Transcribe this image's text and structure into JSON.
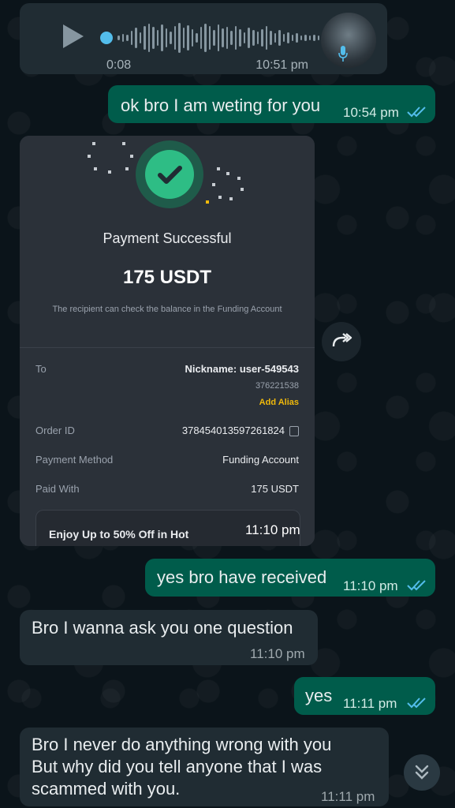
{
  "voice_message": {
    "duration": "0:08",
    "time": "10:51 pm",
    "play_icon": "play-icon",
    "mic_icon": "mic-icon",
    "accent": "#53bdeb"
  },
  "messages": [
    {
      "text": "ok bro I am weting for you",
      "time": "10:54 pm",
      "status": "read"
    },
    {
      "text": "yes bro have received",
      "time": "11:10 pm",
      "status": "read"
    },
    {
      "text": "Bro I wanna ask you one question",
      "time": "11:10 pm"
    },
    {
      "text": "yes",
      "time": "11:11 pm",
      "status": "read"
    },
    {
      "lines": [
        "Bro I never do anything wrong with you",
        "But why did you tell anyone that I was",
        "scammed with you."
      ],
      "time": "11:11 pm"
    }
  ],
  "payment_image": {
    "title": "Payment Successful",
    "amount": "175 USDT",
    "note": "The recipient can check the balance in the Funding Account",
    "to_label": "To",
    "nickname": "Nickname: user-549543",
    "uid": "376221538",
    "add_alias": "Add Alias",
    "order_label": "Order ID",
    "order_id": "378454013597261824",
    "method_label": "Payment Method",
    "method_value": "Funding Account",
    "paid_label": "Paid With",
    "paid_value": "175 USDT",
    "promo": "Enjoy Up to 50% Off in Hot",
    "time": "11:10 pm"
  },
  "colors": {
    "background": "#0b141a",
    "incoming": "#202c33",
    "outgoing": "#005c4b",
    "read_ticks": "#53bdeb",
    "success_green": "#2ebd85",
    "alias_yellow": "#f0b90b"
  },
  "icons": {
    "forward": "forward-icon",
    "scroll_down": "double-chevron-down-icon"
  }
}
